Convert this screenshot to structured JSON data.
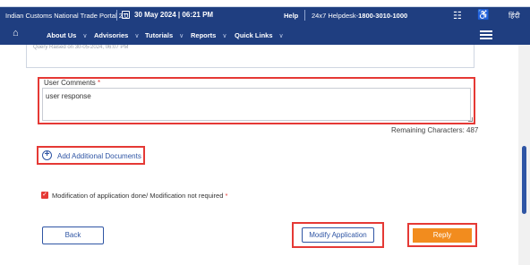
{
  "header": {
    "portal_name": "Indian Customs National Trade Portal 2.0",
    "datetime": "30 May 2024 | 06:21 PM",
    "help": "Help",
    "helpdesk_prefix": "24x7 Helpdesk-",
    "helpdesk_number": "1800-3010-1000",
    "language": "हिंदी",
    "brand_color": "#1f3e80"
  },
  "nav": {
    "items": [
      {
        "label": "About Us",
        "icon": "chevron-down-icon"
      },
      {
        "label": "Advisories",
        "icon": "chevron-down-icon"
      },
      {
        "label": "Tutorials",
        "icon": "chevron-down-icon"
      },
      {
        "label": "Reports",
        "icon": "chevron-down-icon"
      },
      {
        "label": "Quick Links",
        "icon": "chevron-down-icon"
      }
    ]
  },
  "form": {
    "query_partial_text": "Query Raised on 30-05-2024, 06:07 PM",
    "comments_label": "User Comments",
    "required_mark": "*",
    "comments_value": "user response",
    "remaining_label": "Remaining Characters: 487",
    "add_docs_label": "Add Additional Documents",
    "checkbox_label": "Modification of application done/ Modification not required",
    "checkbox_checked": true
  },
  "actions": {
    "back": "Back",
    "modify": "Modify Application",
    "reply": "Reply",
    "highlight_color": "#e53935",
    "reply_color": "#f28c1e"
  }
}
